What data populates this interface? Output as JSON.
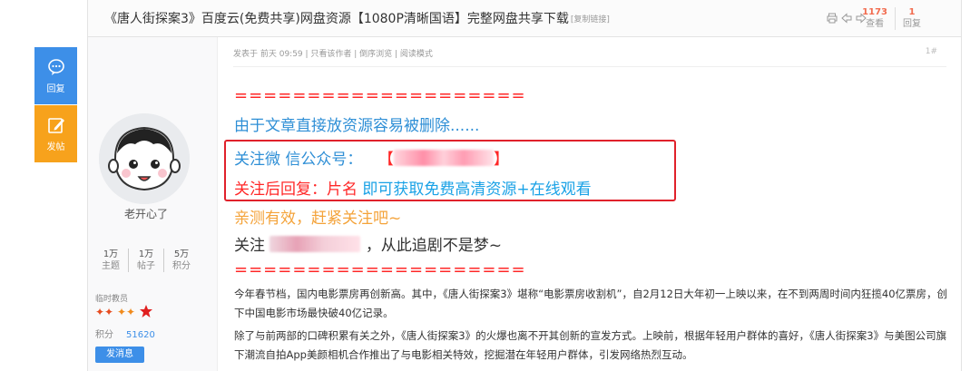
{
  "float_bar": {
    "reply_label": "回复",
    "post_label": "发帖"
  },
  "header": {
    "title": "《唐人街探案3》百度云(免费共享)网盘资源【1080P清晰国语】完整网盘共享下载",
    "copy_link": "[复制链接]",
    "views_num": "1173",
    "views_label": "查看",
    "replies_num": "1",
    "replies_label": "回复"
  },
  "author": {
    "name": "老开心了",
    "stats": [
      {
        "value": "1万",
        "label": "主题"
      },
      {
        "value": "1万",
        "label": "帖子"
      },
      {
        "value": "5万",
        "label": "积分"
      }
    ],
    "rank": "临时教员",
    "points_label": "积分",
    "points_value": "51620",
    "message_button": "发消息"
  },
  "post": {
    "meta": "发表于 前天 09:59  |  只看该作者  |  倒序浏览  |  阅读模式",
    "floor": "1#",
    "separator": "====================",
    "line1": "由于文章直接放资源容易被删除......",
    "line2_prefix": "关注微 信公众号：",
    "line2_bracket_open": "【",
    "line2_bracket_close": "】",
    "line3_red": "关注后回复：片名",
    "line3_cyan": "即可获取免费高清资源+在线观看",
    "line4": "亲测有效，赶紧关注吧~",
    "line5_prefix": "关注",
    "line5_suffix": "，从此追剧不是梦~",
    "separator2": "====================",
    "para1": "今年春节档，国内电影票房再创新高。其中，《唐人街探案3》堪称“电影票房收割机”，自2月12日大年初一上映以来，在不到两周时间内狂揽40亿票房，创下中国电影市场最快破40亿记录。",
    "para2": "除了与前两部的口碑积累有关之外，《唐人街探案3》的火爆也离不开其创新的宣发方式。上映前，根据年轻用户群体的喜好，《唐人街探案3》与美图公司旗下潮流自拍App美颜相机合作推出了与电影相关特效，挖掘潜在年轻用户群体，引发网络热烈互动。"
  },
  "colors": {
    "accent_blue": "#3d8fe8",
    "accent_orange": "#f7a21c",
    "highlight_red": "#e0212b"
  }
}
